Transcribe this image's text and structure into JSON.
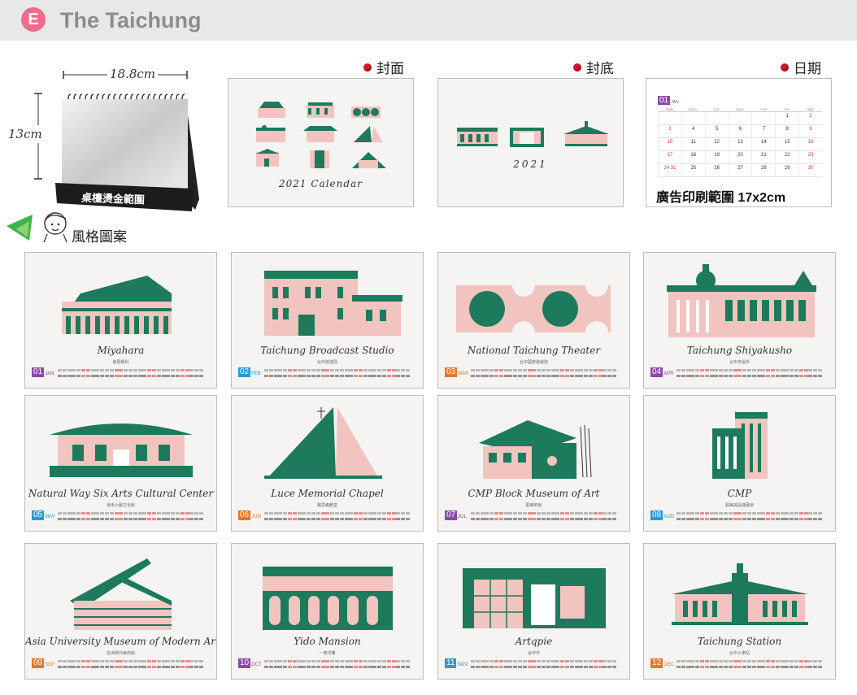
{
  "header": {
    "badge": "E",
    "title": "The Taichung"
  },
  "desk_calendar": {
    "width_label": "18.8cm",
    "height_label": "13cm",
    "foil_label": "桌檯燙金範圍"
  },
  "style_section": {
    "label": "風格圖案"
  },
  "previews": {
    "cover": {
      "label": "封面",
      "caption": "2021 Calendar"
    },
    "back": {
      "label": "封底",
      "caption": "2021"
    },
    "date": {
      "label": "日期",
      "month_num": "01",
      "month_abbr": "JAN",
      "weekdays": [
        "SUN",
        "MON",
        "TUE",
        "WED",
        "THU",
        "FRI",
        "SAT"
      ],
      "weeks": [
        [
          "",
          "",
          "",
          "",
          "",
          "1",
          "2"
        ],
        [
          "3",
          "4",
          "5",
          "6",
          "7",
          "8",
          "9"
        ],
        [
          "10",
          "11",
          "12",
          "13",
          "14",
          "15",
          "16"
        ],
        [
          "17",
          "18",
          "19",
          "20",
          "21",
          "22",
          "23"
        ],
        [
          "24 31",
          "25",
          "26",
          "27",
          "28",
          "29",
          "30"
        ]
      ],
      "ad_range_label": "廣告印刷範圍 17x2cm"
    }
  },
  "months": [
    {
      "num": "01",
      "abbr": "JAN",
      "title": "Miyahara",
      "subtitle": "宮原眼科",
      "color": "#8e4aa8"
    },
    {
      "num": "02",
      "abbr": "FEB",
      "title": "Taichung Broadcast Studio",
      "subtitle": "台中放送局",
      "color": "#2a9ad4"
    },
    {
      "num": "03",
      "abbr": "MAR",
      "title": "National Taichung Theater",
      "subtitle": "台中國家歌劇院",
      "color": "#e8762a"
    },
    {
      "num": "04",
      "abbr": "APR",
      "title": "Taichung Shiyakusho",
      "subtitle": "台中市役所",
      "color": "#8e4aa8"
    },
    {
      "num": "05",
      "abbr": "MAY",
      "title": "Natural Way Six Arts Cultural Center",
      "subtitle": "道禾六藝文化館",
      "color": "#2a9ad4"
    },
    {
      "num": "06",
      "abbr": "JUN",
      "title": "Luce Memorial Chapel",
      "subtitle": "路思義教堂",
      "color": "#e8762a"
    },
    {
      "num": "07",
      "abbr": "JUL",
      "title": "CMP Block Museum of Art",
      "subtitle": "勤美術館",
      "color": "#8e4aa8"
    },
    {
      "num": "08",
      "abbr": "AUG",
      "title": "CMP",
      "subtitle": "勤美誠品綠園道",
      "color": "#2a9ad4"
    },
    {
      "num": "09",
      "abbr": "SEP",
      "title": "Asia University Museum of Modern Art",
      "subtitle": "亞洲現代美術館",
      "color": "#e8762a"
    },
    {
      "num": "10",
      "abbr": "OCT",
      "title": "Yido Mansion",
      "subtitle": "一德洋樓",
      "color": "#8e4aa8"
    },
    {
      "num": "11",
      "abbr": "NOV",
      "title": "Artqpie",
      "subtitle": "台中市",
      "color": "#2a9ad4"
    },
    {
      "num": "12",
      "abbr": "DEC",
      "title": "Taichung Station",
      "subtitle": "台中火車站",
      "color": "#e8762a"
    }
  ],
  "colors": {
    "green": "#1e7a5c",
    "pink": "#f2c4c0",
    "dot": "#d4142c",
    "badge": "#f06b8a"
  }
}
